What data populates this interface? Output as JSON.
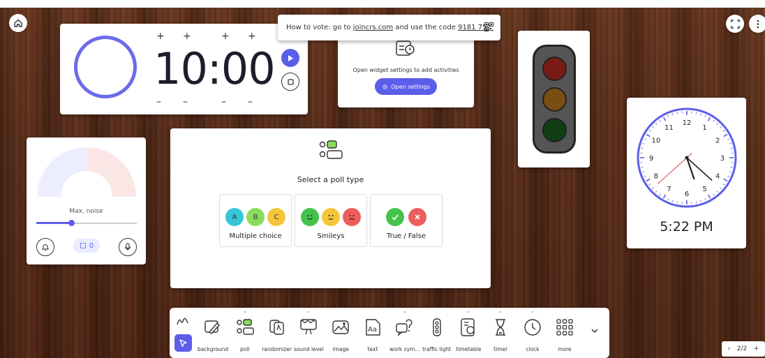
{
  "vote_banner": {
    "prefix": "How to vote: go to",
    "site": "joincrs.com",
    "middle": "and use the code",
    "code": "9181 752"
  },
  "timer": {
    "display": "10:00",
    "plus": "+",
    "minus": "–"
  },
  "settings_widget": {
    "message": "Open widget settings to add activities",
    "button": "Open settings"
  },
  "clock": {
    "time": "5:22 PM",
    "numbers": [
      "12",
      "1",
      "2",
      "3",
      "4",
      "5",
      "6",
      "7",
      "8",
      "9",
      "10",
      "11"
    ]
  },
  "noise": {
    "label": "Max. noise",
    "count": "0",
    "level": 0.35
  },
  "poll": {
    "title": "Select a poll type",
    "options": [
      {
        "label": "Multiple choice",
        "letters": [
          "A",
          "B",
          "C"
        ]
      },
      {
        "label": "Smileys"
      },
      {
        "label": "True / False"
      }
    ]
  },
  "toolbar": {
    "tools": [
      {
        "label": "background",
        "icon": "background-icon"
      },
      {
        "label": "poll",
        "icon": "poll-icon"
      },
      {
        "label": "randomizer",
        "icon": "randomizer-icon"
      },
      {
        "label": "sound level",
        "icon": "sound-level-icon"
      },
      {
        "label": "image",
        "icon": "image-icon"
      },
      {
        "label": "text",
        "icon": "text-icon"
      },
      {
        "label": "work sym...",
        "icon": "work-symbols-icon"
      },
      {
        "label": "traffic light",
        "icon": "traffic-light-icon"
      },
      {
        "label": "timetable",
        "icon": "timetable-icon"
      },
      {
        "label": "timer",
        "icon": "hourglass-icon"
      },
      {
        "label": "clock",
        "icon": "clock-icon"
      },
      {
        "label": "more",
        "icon": "grid-icon"
      }
    ]
  },
  "pager": {
    "prev": "‹",
    "page": "2/2",
    "add": "+"
  },
  "colors": {
    "accent": "#5b5ee8",
    "traffic_red": "#7a1a14",
    "traffic_amber": "#7a4d12",
    "traffic_green": "#0f3d14"
  }
}
